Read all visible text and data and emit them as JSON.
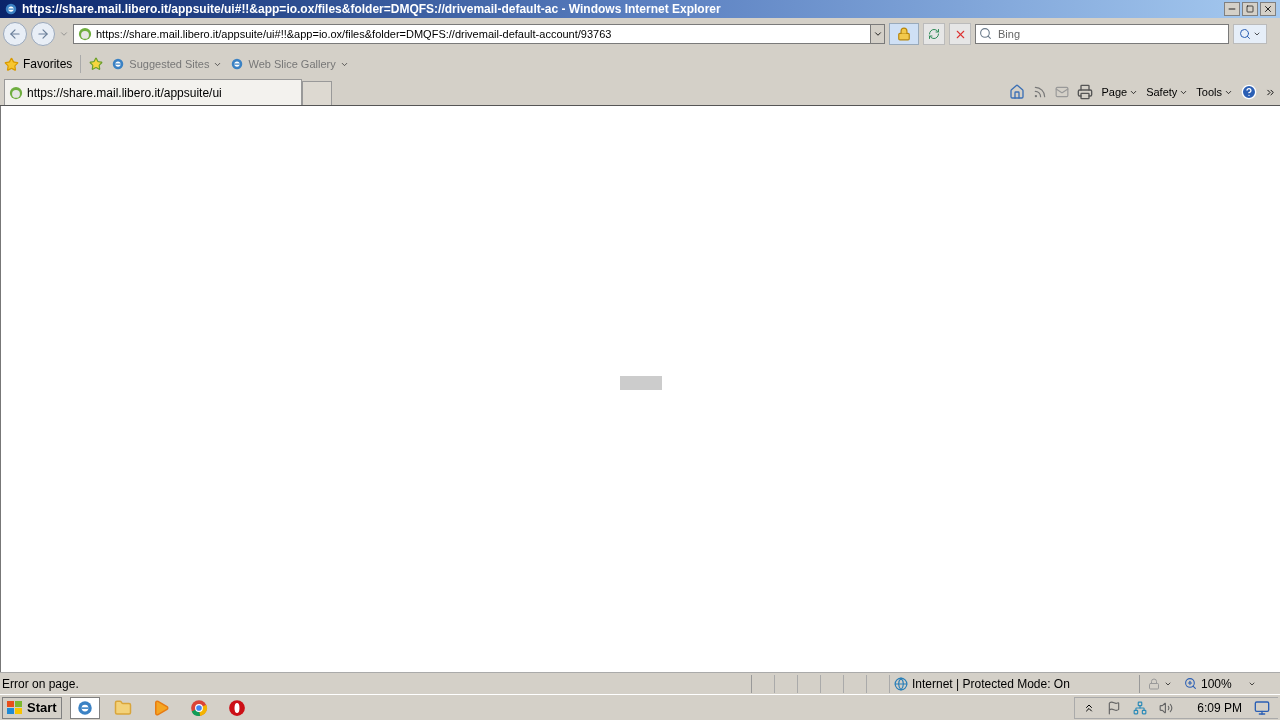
{
  "window": {
    "title": "https://share.mail.libero.it/appsuite/ui#!!&app=io.ox/files&folder=DMQFS://drivemail-default-ac - Windows Internet Explorer"
  },
  "address_bar": {
    "url": "https://share.mail.libero.it/appsuite/ui#!!&app=io.ox/files&folder=DMQFS://drivemail-default-account/93763",
    "search_placeholder": "Bing"
  },
  "favorites_bar": {
    "items": [
      {
        "label": "Favorites",
        "kind": "favorites"
      },
      {
        "label": "Suggested Sites",
        "kind": "link"
      },
      {
        "label": "Web Slice Gallery",
        "kind": "link"
      }
    ]
  },
  "tabs": [
    {
      "label": "https://share.mail.libero.it/appsuite/ui",
      "selected": true
    }
  ],
  "command_bar": {
    "menus": [
      "Page",
      "Safety",
      "Tools"
    ]
  },
  "status_bar": {
    "text": "Error on page.",
    "zone": "Internet | Protected Mode: On",
    "zoom": "100%"
  },
  "taskbar": {
    "start": "Start",
    "clock": "6:09 PM",
    "apps": [
      {
        "kind": "ie",
        "selected": true
      },
      {
        "kind": "folder",
        "selected": false
      },
      {
        "kind": "media",
        "selected": false
      },
      {
        "kind": "chrome",
        "selected": false
      },
      {
        "kind": "opera",
        "selected": false
      }
    ]
  }
}
